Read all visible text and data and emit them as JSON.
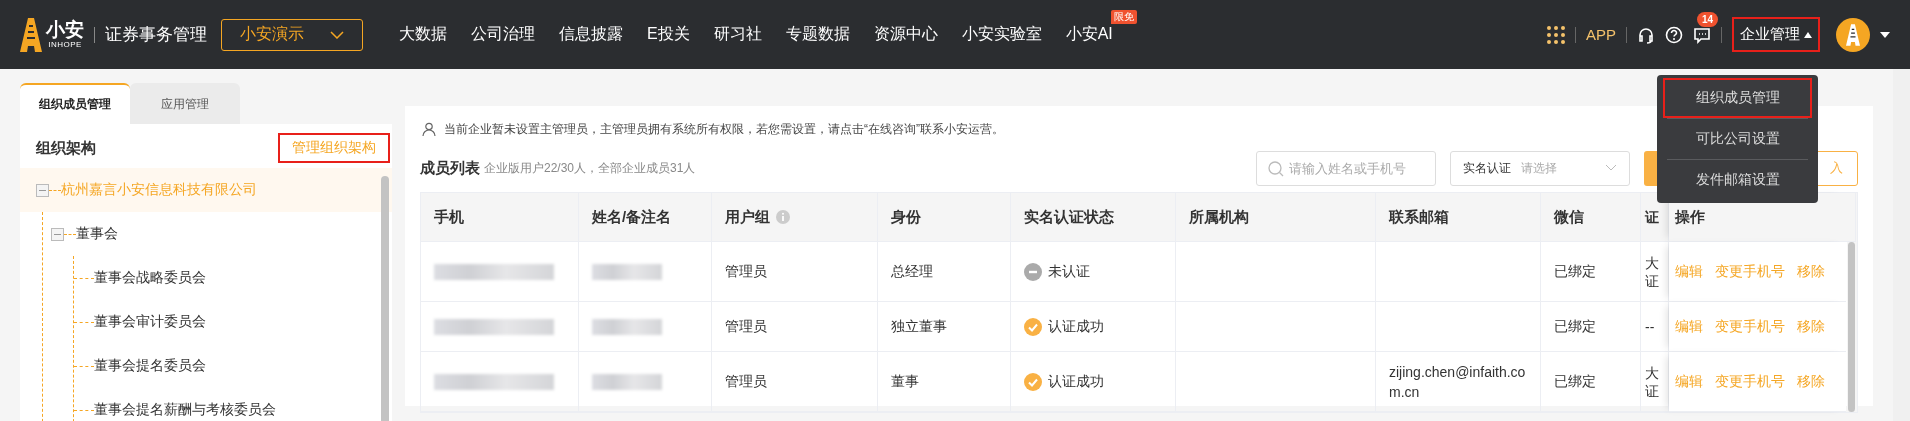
{
  "header": {
    "logo_text": "小安",
    "logo_subtext": "INHOPE",
    "product": "证券事务管理",
    "workspace": "小安演示",
    "nav": [
      {
        "label": "大数据"
      },
      {
        "label": "公司治理"
      },
      {
        "label": "信息披露"
      },
      {
        "label": "E投关"
      },
      {
        "label": "研习社"
      },
      {
        "label": "专题数据"
      },
      {
        "label": "资源中心"
      },
      {
        "label": "小安实验室"
      },
      {
        "label": "小安AI",
        "badge": "限免"
      }
    ],
    "app_link": "APP",
    "notification_count": "14",
    "admin_menu": {
      "label": "企业管理",
      "highlighted": true,
      "expanded": true,
      "items": [
        {
          "label": "组织成员管理",
          "highlighted": true
        },
        {
          "label": "可比公司设置",
          "highlighted": false
        },
        {
          "label": "发件邮箱设置",
          "highlighted": false
        }
      ]
    }
  },
  "tabs": [
    {
      "label": "组织成员管理",
      "selected": true
    },
    {
      "label": "应用管理",
      "selected": false
    }
  ],
  "org_panel": {
    "title": "组织架构",
    "manage_link": {
      "label": "管理组织架构",
      "highlighted": true
    },
    "tree": [
      {
        "label": "杭州嘉言小安信息科技有限公司",
        "selected": true,
        "expanded": true,
        "children": [
          {
            "label": "董事会",
            "selected": false,
            "expanded": true,
            "children": [
              {
                "label": "董事会战略委员会",
                "selected": false
              },
              {
                "label": "董事会审计委员会",
                "selected": false
              },
              {
                "label": "董事会提名委员会",
                "selected": false
              },
              {
                "label": "董事会提名薪酬与考核委员会",
                "selected": false
              }
            ]
          }
        ]
      }
    ]
  },
  "members": {
    "notice": "当前企业暂未设置主管理员，主管理员拥有系统所有权限，若您需设置，请点击“在线咨询”联系小安运营。",
    "title": "成员列表",
    "summary": "企业版用户22/30人，全部企业成员31人",
    "search": {
      "placeholder": "请输入姓名或手机号"
    },
    "filter": {
      "label": "实名认证",
      "placeholder": "请选择"
    },
    "import_button": "入",
    "table": {
      "columns": [
        {
          "label": "手机"
        },
        {
          "label": "姓名/备注名"
        },
        {
          "label": "用户组",
          "info_icon": true
        },
        {
          "label": "身份"
        },
        {
          "label": "实名认证状态"
        },
        {
          "label": "所属机构"
        },
        {
          "label": "联系邮箱"
        },
        {
          "label": "微信"
        },
        {
          "label": "证"
        },
        {
          "label": "操作"
        }
      ],
      "rows": [
        {
          "user_group": "管理员",
          "identity": "总经理",
          "verified": false,
          "status": "未认证",
          "wechat": "已绑定",
          "column_9": "大证",
          "actions": [
            "编辑",
            "变更手机号",
            "移除"
          ]
        },
        {
          "user_group": "管理员",
          "identity": "独立董事",
          "verified": true,
          "status": "认证成功",
          "wechat": "已绑定",
          "column_9": "--",
          "actions": [
            "编辑",
            "变更手机号",
            "移除"
          ]
        },
        {
          "user_group": "管理员",
          "identity": "董事",
          "verified": true,
          "status": "认证成功",
          "email": "zijing.chen@infaith.com.cn",
          "wechat": "已绑定",
          "column_9": "大证",
          "actions": [
            "编辑",
            "变更手机号",
            "移除"
          ]
        }
      ]
    }
  }
}
